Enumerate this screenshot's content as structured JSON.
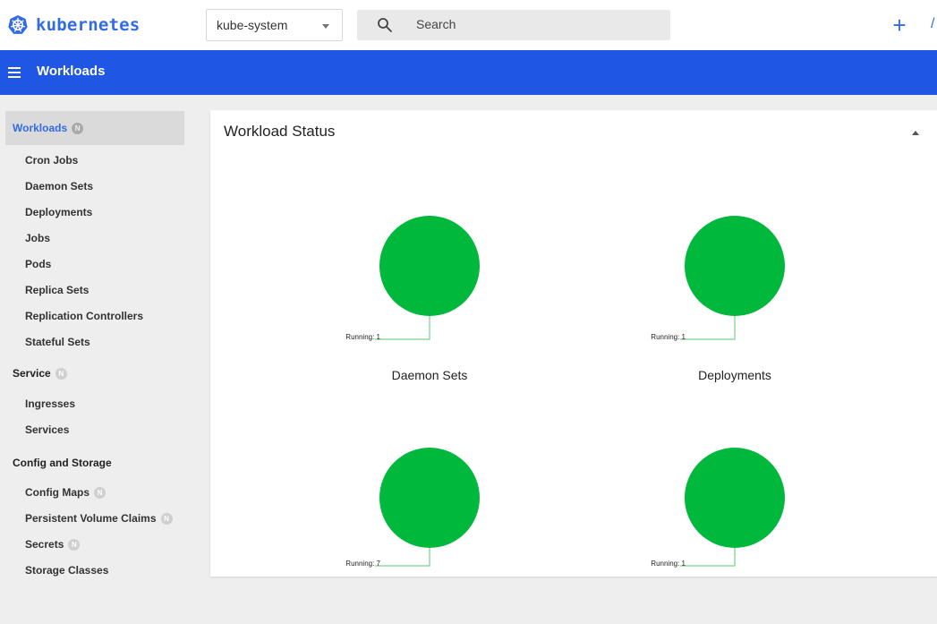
{
  "header": {
    "logo_text": "kubernetes",
    "namespace": "kube-system",
    "search_placeholder": "Search",
    "create_label": "+",
    "edge_glyph": "/"
  },
  "appbar": {
    "title": "Workloads"
  },
  "sidebar": {
    "badge": "N",
    "groups": [
      {
        "label": "Workloads",
        "active": true,
        "badge": true
      },
      {
        "label": "Service",
        "active": false,
        "badge": true
      },
      {
        "label": "Config and Storage",
        "active": false,
        "badge": false
      }
    ],
    "workload_items": [
      "Cron Jobs",
      "Daemon Sets",
      "Deployments",
      "Jobs",
      "Pods",
      "Replica Sets",
      "Replication Controllers",
      "Stateful Sets"
    ],
    "service_items": [
      "Ingresses",
      "Services"
    ],
    "config_items": [
      {
        "label": "Config Maps",
        "badge": true
      },
      {
        "label": "Persistent Volume Claims",
        "badge": true
      },
      {
        "label": "Secrets",
        "badge": true
      },
      {
        "label": "Storage Classes",
        "badge": false
      }
    ]
  },
  "main": {
    "title": "Workload Status",
    "charts": [
      {
        "caption": "Daemon Sets",
        "label": "Running: 1",
        "status": "Running",
        "count": 1
      },
      {
        "caption": "Deployments",
        "label": "Running: 1",
        "status": "Running",
        "count": 1
      },
      {
        "caption": "",
        "label": "Running: 7",
        "status": "Running",
        "count": 7
      },
      {
        "caption": "",
        "label": "Running: 1",
        "status": "Running",
        "count": 1
      }
    ]
  },
  "colors": {
    "brand": "#326ce5",
    "appbar": "#1f56e3",
    "running": "#00b83c",
    "leader_line": "#8fd99f"
  }
}
